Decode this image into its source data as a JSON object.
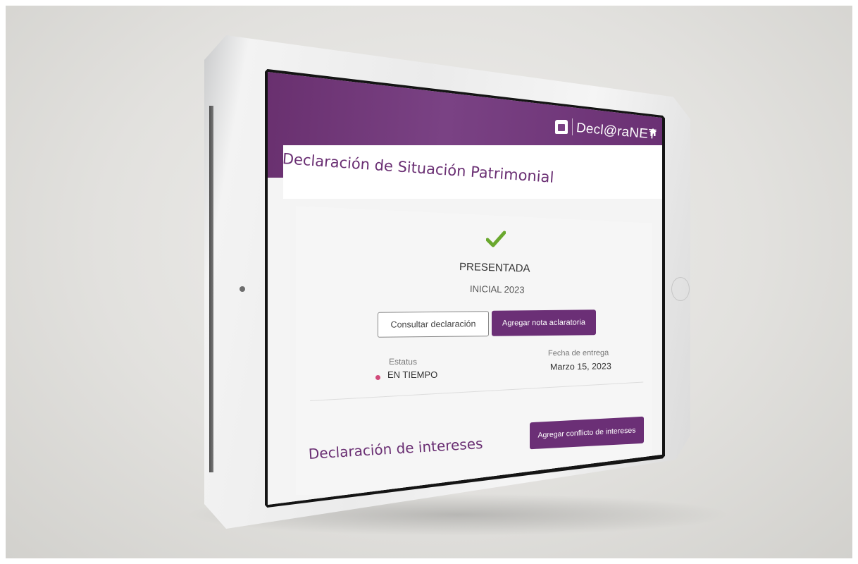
{
  "app": {
    "logo_text": "Decl@raNET"
  },
  "page": {
    "title": "Declaración de Situación Patrimonial"
  },
  "status": {
    "state": "PRESENTADA",
    "declaration_type": "INICIAL 2023"
  },
  "actions": {
    "consult_label": "Consultar declaración",
    "add_note_label": "Agregar nota aclaratoria",
    "add_conflict_label": "Agregar conflicto de intereses"
  },
  "details": {
    "status_label": "Estatus",
    "status_value": "EN TIEMPO",
    "date_label": "Fecha de entrega",
    "date_value": "Marzo 15, 2023"
  },
  "interests": {
    "title": "Declaración de intereses"
  },
  "colors": {
    "brand_purple": "#6b2f76",
    "success_green": "#6aa82e",
    "status_dot": "#d14a7a"
  },
  "icons": {
    "logo": "building-seal-icon",
    "home": "home-icon",
    "status": "check-icon"
  }
}
